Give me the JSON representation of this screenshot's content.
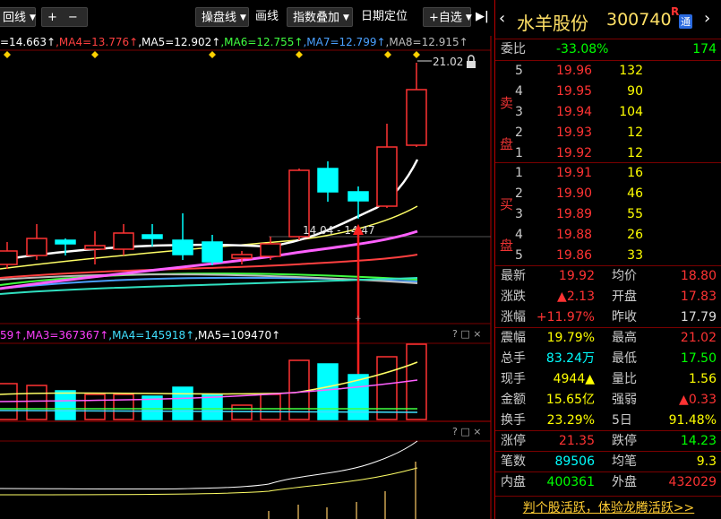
{
  "toolbar": {
    "period_label": "回线",
    "plus": "+",
    "minus": "−",
    "operate_line": "操盘线",
    "draw_line": "画线",
    "index_overlay": "指数叠加",
    "date_locate": "日期定位",
    "add_watch": "+自选",
    "collapse": "▶|"
  },
  "ma_legend": [
    {
      "text": "=14.663↑",
      "color": "#ffffff"
    },
    {
      "text": ",MA4=13.776↑",
      "color": "#ff4040"
    },
    {
      "text": ",MA5=12.902↑",
      "color": "#ffffff"
    },
    {
      "text": ",MA6=12.755↑",
      "color": "#40ff40"
    },
    {
      "text": ",MA7=12.799↑",
      "color": "#4aa0ff"
    },
    {
      "text": ",MA8=12.915↑",
      "color": "#bbbbbb"
    }
  ],
  "price_high_label": "21.02",
  "range_label": "14.04 - 14.47",
  "vol_legend": [
    {
      "text": "59↑",
      "color": "#ff40ff"
    },
    {
      "text": ",MA3=367367↑",
      "color": "#ff40ff"
    },
    {
      "text": ",MA4=145918↑",
      "color": "#40e0ff"
    },
    {
      "text": ",MA5=109470↑",
      "color": "#ffffff"
    }
  ],
  "panel_icons": "? □ ×",
  "stock": {
    "name": "水羊股份",
    "code": "300740",
    "badge_r": "R",
    "badge_t": "通"
  },
  "weibi": {
    "label": "委比",
    "pct": "-33.08%",
    "diff": "174"
  },
  "sell_side": "卖盘",
  "buy_side": "买盘",
  "asks": [
    {
      "level": "5",
      "price": "19.96",
      "vol": "132"
    },
    {
      "level": "4",
      "price": "19.95",
      "vol": "90"
    },
    {
      "level": "3",
      "price": "19.94",
      "vol": "104"
    },
    {
      "level": "2",
      "price": "19.93",
      "vol": "12"
    },
    {
      "level": "1",
      "price": "19.92",
      "vol": "12"
    }
  ],
  "bids": [
    {
      "level": "1",
      "price": "19.91",
      "vol": "16"
    },
    {
      "level": "2",
      "price": "19.90",
      "vol": "46"
    },
    {
      "level": "3",
      "price": "19.89",
      "vol": "55"
    },
    {
      "level": "4",
      "price": "19.88",
      "vol": "26"
    },
    {
      "level": "5",
      "price": "19.86",
      "vol": "33"
    }
  ],
  "stats": [
    {
      "l1": "最新",
      "v1": "19.92",
      "c1": "red",
      "l2": "均价",
      "v2": "18.80",
      "c2": "red"
    },
    {
      "l1": "涨跌",
      "v1": "▲2.13",
      "c1": "red",
      "l2": "开盘",
      "v2": "17.83",
      "c2": "red"
    },
    {
      "l1": "涨幅",
      "v1": "+11.97%",
      "c1": "red",
      "l2": "昨收",
      "v2": "17.79",
      "c2": "white"
    },
    {
      "l1": "震幅",
      "v1": "19.79%",
      "c1": "yellow",
      "l2": "最高",
      "v2": "21.02",
      "c2": "red"
    },
    {
      "l1": "总手",
      "v1": "83.24万",
      "c1": "cyan",
      "l2": "最低",
      "v2": "17.50",
      "c2": "green"
    },
    {
      "l1": "现手",
      "v1": "4944▲",
      "c1": "yellow",
      "l2": "量比",
      "v2": "1.56",
      "c2": "yellow"
    },
    {
      "l1": "金额",
      "v1": "15.65亿",
      "c1": "yellow",
      "l2": "强弱",
      "v2": "▲0.33",
      "c2": "red"
    },
    {
      "l1": "换手",
      "v1": "23.29%",
      "c1": "yellow",
      "l2": "5日",
      "v2": "91.48%",
      "c2": "yellow"
    },
    {
      "l1": "涨停",
      "v1": "21.35",
      "c1": "red",
      "l2": "跌停",
      "v2": "14.23",
      "c2": "green"
    },
    {
      "l1": "笔数",
      "v1": "89506",
      "c1": "cyan",
      "l2": "均笔",
      "v2": "9.3",
      "c2": "yellow"
    },
    {
      "l1": "内盘",
      "v1": "400361",
      "c1": "green",
      "l2": "外盘",
      "v2": "432029",
      "c2": "red"
    }
  ],
  "promo": "判个股活跃，体验龙腾活跃>>",
  "colors": {
    "up": "#ff3333",
    "down": "#00ffff",
    "bg": "#000000",
    "grid": "#7a0000"
  }
}
